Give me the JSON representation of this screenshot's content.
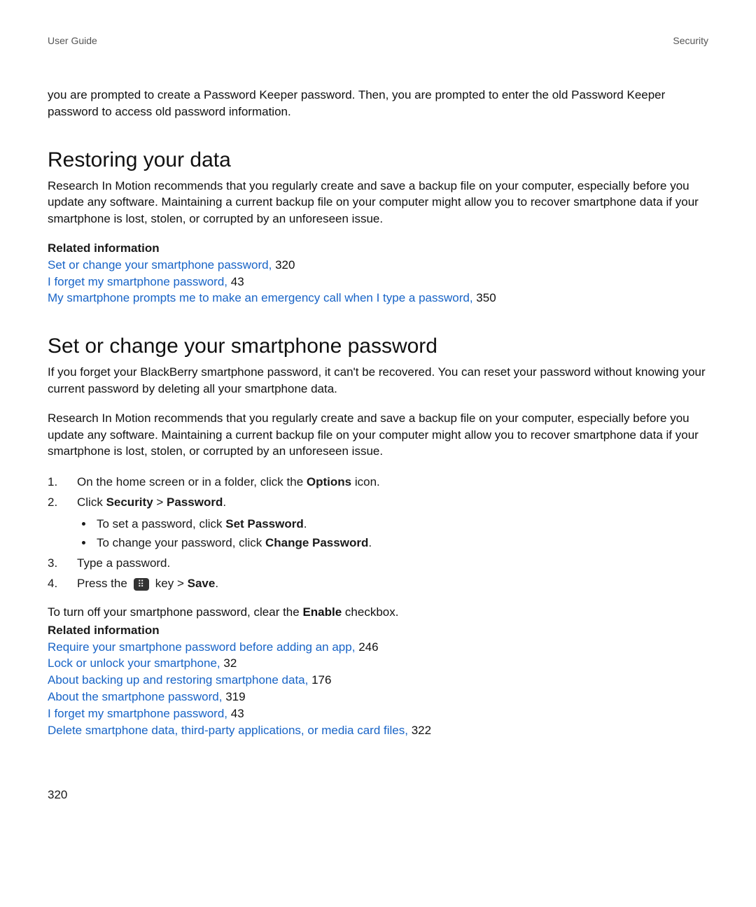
{
  "header": {
    "left": "User Guide",
    "right": "Security"
  },
  "intro_para": "you are prompted to create a Password Keeper password. Then, you are prompted to enter the old Password Keeper password to access old password information.",
  "section1": {
    "heading": "Restoring your data",
    "para": "Research In Motion recommends that you regularly create and save a backup file on your computer, especially before you update any software. Maintaining a current backup file on your computer might allow you to recover smartphone data if your smartphone is lost, stolen, or corrupted by an unforeseen issue.",
    "related_label": "Related information",
    "links": [
      {
        "text": "Set or change your smartphone password,",
        "page": "320"
      },
      {
        "text": "I forget my smartphone password,",
        "page": "43"
      },
      {
        "text": "My smartphone prompts me to make an emergency call when I type a password,",
        "page": "350"
      }
    ]
  },
  "section2": {
    "heading": "Set or change your smartphone password",
    "para1": "If you forget your BlackBerry smartphone password, it can't be recovered. You can reset your password without knowing your current password by deleting all your smartphone data.",
    "para2": "Research In Motion recommends that you regularly create and save a backup file on your computer, especially before you update any software. Maintaining a current backup file on your computer might allow you to recover smartphone data if your smartphone is lost, stolen, or corrupted by an unforeseen issue.",
    "step1_a": "On the home screen or in a folder, click the ",
    "step1_bold": "Options",
    "step1_b": " icon.",
    "step2_a": "Click ",
    "step2_bold1": "Security",
    "step2_sep": " > ",
    "step2_bold2": "Password",
    "step2_end": ".",
    "sub1_a": "To set a password, click ",
    "sub1_bold": "Set Password",
    "sub1_end": ".",
    "sub2_a": "To change your password, click ",
    "sub2_bold": "Change Password",
    "sub2_end": ".",
    "step3": "Type a password.",
    "step4_a": "Press the ",
    "step4_key": "⠿",
    "step4_b": " key > ",
    "step4_bold": "Save",
    "step4_end": ".",
    "closing_a": "To turn off your smartphone password, clear the ",
    "closing_bold": "Enable",
    "closing_b": " checkbox.",
    "related_label": "Related information",
    "links": [
      {
        "text": "Require your smartphone password before adding an app,",
        "page": "246"
      },
      {
        "text": "Lock or unlock your smartphone,",
        "page": "32"
      },
      {
        "text": "About backing up and restoring smartphone data,",
        "page": "176"
      },
      {
        "text": "About the smartphone password,",
        "page": "319"
      },
      {
        "text": "I forget my smartphone password,",
        "page": "43"
      },
      {
        "text": "Delete smartphone data, third-party applications, or media card files,",
        "page": "322"
      }
    ]
  },
  "footer_page": "320"
}
